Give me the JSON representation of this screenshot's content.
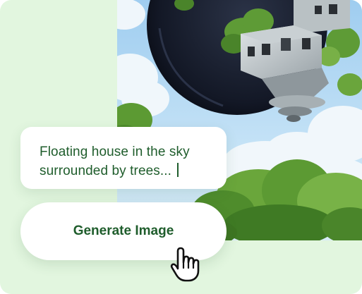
{
  "prompt": {
    "text": "Floating house in the sky surrounded by trees..."
  },
  "generate_button": {
    "label": "Generate Image"
  },
  "icons": {
    "cursor": "hand-pointer-icon"
  },
  "colors": {
    "card_background": "#e2f6df",
    "text_green": "#1f5d2c",
    "sky_blue": "#a9d3f3",
    "foliage_green": "#5f9a38"
  }
}
